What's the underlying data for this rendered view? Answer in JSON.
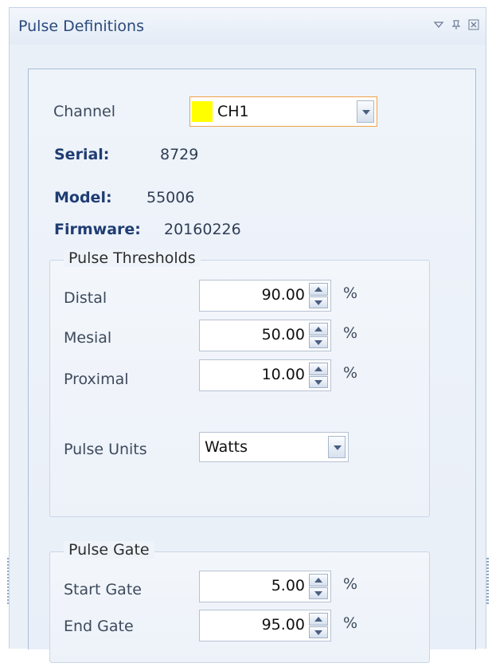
{
  "window": {
    "title": "Pulse Definitions",
    "icons": [
      "dropdown-arrow-icon",
      "pin-icon",
      "close-icon"
    ]
  },
  "channel": {
    "label": "Channel",
    "value": "CH1",
    "swatch_color": "#ffff00"
  },
  "info": {
    "serial_key": "Serial:",
    "serial_value": "8729",
    "model_key": "Model:",
    "model_value": "55006",
    "firmware_key": "Firmware:",
    "firmware_value": "20160226"
  },
  "thresholds": {
    "legend": "Pulse Thresholds",
    "distal_label": "Distal",
    "distal_value": "90.00",
    "mesial_label": "Mesial",
    "mesial_value": "50.00",
    "proximal_label": "Proximal",
    "proximal_value": "10.00",
    "unit": "%",
    "pulse_units_label": "Pulse Units",
    "pulse_units_value": "Watts"
  },
  "gate": {
    "legend": "Pulse Gate",
    "start_label": "Start Gate",
    "start_value": "5.00",
    "end_label": "End Gate",
    "end_value": "95.00",
    "unit": "%"
  },
  "colors": {
    "title_text": "#2a4a7c",
    "key_text": "#1f3d73",
    "active_border": "#f0a24a"
  }
}
